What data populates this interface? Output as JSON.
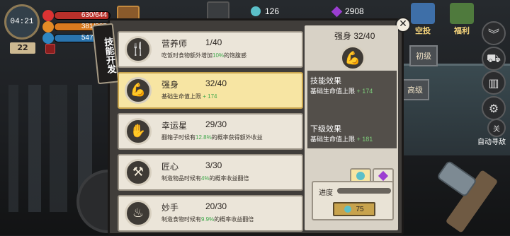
{
  "hud": {
    "clock": "04:21",
    "day": "22",
    "health": {
      "value": "630/644",
      "percent": 97.8
    },
    "hunger": {
      "value": "381/385",
      "percent": 98.9
    },
    "thirst": {
      "value": "547/555",
      "percent": 98.6
    }
  },
  "currency": {
    "coins": "126",
    "gems": "2908"
  },
  "top_right": {
    "airdrop_label": "空投",
    "welfare_label": "福利"
  },
  "side": {
    "primary_tab": "初级",
    "advanced_tab": "高级",
    "close_small": "关",
    "auto_search": "自动寻敌"
  },
  "panel": {
    "title": "技能开发",
    "skills": [
      {
        "name": "营养师",
        "level": "1/40",
        "desc_pre": "吃饭时食物额外增加",
        "desc_hl": "10%",
        "desc_post": "的饱腹感",
        "icon": "cutlery-icon"
      },
      {
        "name": "强身",
        "level": "32/40",
        "desc_pre": "基础生命值上限 ",
        "desc_hl": "+ 174",
        "desc_post": "",
        "icon": "muscle-icon"
      },
      {
        "name": "幸运星",
        "level": "29/30",
        "desc_pre": "翻箱子时候有",
        "desc_hl": "12.8%",
        "desc_post": "的概率获得额外收益",
        "icon": "hand-icon"
      },
      {
        "name": "匠心",
        "level": "3/30",
        "desc_pre": "制造物品时候有",
        "desc_hl": "4%",
        "desc_post": "的概率收益翻倍",
        "icon": "tools-icon"
      },
      {
        "name": "妙手",
        "level": "20/30",
        "desc_pre": "制造食物时候有",
        "desc_hl": "9.9%",
        "desc_post": "的概率收益翻倍",
        "icon": "chef-hat-icon"
      }
    ]
  },
  "detail": {
    "title": "强身",
    "level": "32/40",
    "effect_header": "技能效果",
    "effect_line_pre": "基础生命值上限 ",
    "effect_line_val": "+ 174",
    "next_header": "下级效果",
    "next_line_pre": "基础生命值上限 ",
    "next_line_val": "+ 181",
    "progress_label": "进度",
    "progress_percent": 0,
    "upgrade_cost": "75"
  },
  "colors": {
    "highlight_green": "#3fa84a",
    "selected_card": "#f7e5a3",
    "health_bar": "#c0392b",
    "hunger_bar": "#e67e22",
    "thirst_bar": "#2e86c1"
  }
}
